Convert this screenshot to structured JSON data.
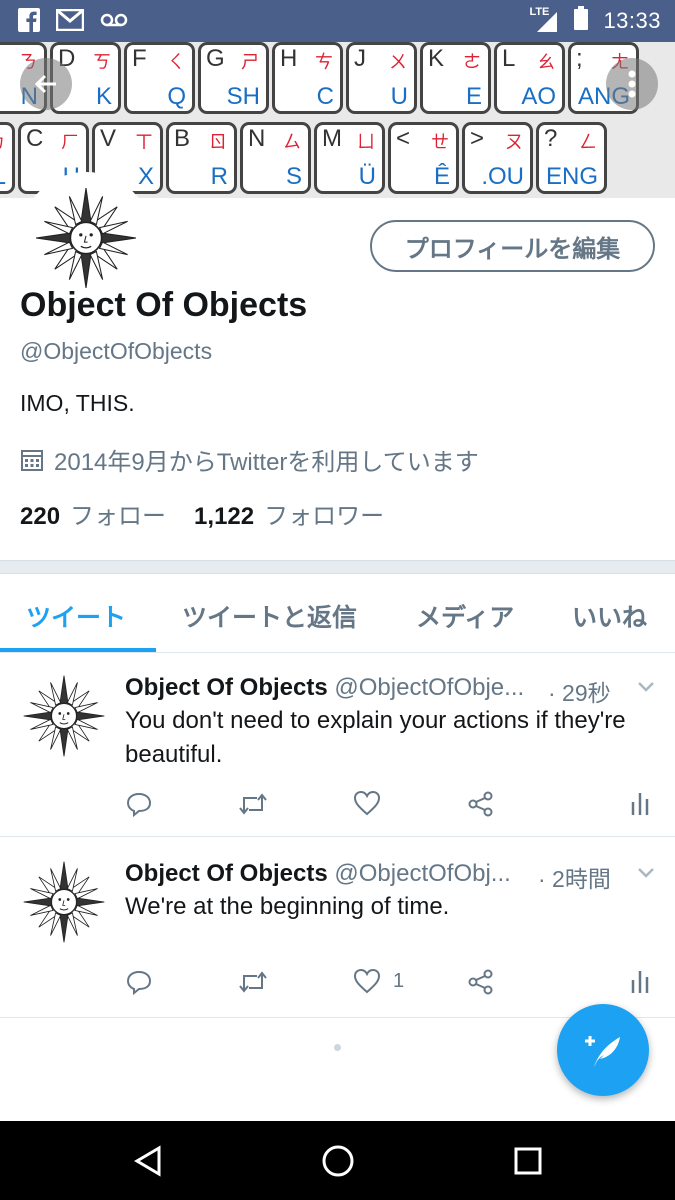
{
  "status_bar": {
    "time": "13:33",
    "network": "LTE",
    "notification_icons": [
      "facebook-icon",
      "gmail-icon",
      "voicemail-icon"
    ],
    "background": "#4a5f8a"
  },
  "banner": {
    "row1": [
      {
        "tl": "S",
        "tr": "ㄋ",
        "bt": "N"
      },
      {
        "tl": "D",
        "tr": "ㄎ",
        "bt": "K"
      },
      {
        "tl": "F",
        "tr": "ㄑ",
        "bt": "Q"
      },
      {
        "tl": "G",
        "tr": "ㄕ",
        "bt": "SH"
      },
      {
        "tl": "H",
        "tr": "ㄘ",
        "bt": "C"
      },
      {
        "tl": "J",
        "tr": "ㄨ",
        "bt": "U"
      },
      {
        "tl": "K",
        "tr": "ㄜ",
        "bt": "E"
      },
      {
        "tl": "L",
        "tr": "ㄠ",
        "bt": "AO"
      },
      {
        "tl": ";",
        "tr": "ㄤ",
        "bt": "ANG"
      }
    ],
    "row2": [
      {
        "tl": "X",
        "tr": "ㄌ",
        "bt": "L"
      },
      {
        "tl": "C",
        "tr": "ㄏ",
        "bt": "H"
      },
      {
        "tl": "V",
        "tr": "ㄒ",
        "bt": "X"
      },
      {
        "tl": "B",
        "tr": "ㄖ",
        "bt": "R"
      },
      {
        "tl": "N",
        "tr": "ㄙ",
        "bt": "S"
      },
      {
        "tl": "M",
        "tr": "ㄩ",
        "bt": "Ü"
      },
      {
        "tl": "<",
        "tr": "ㄝ",
        "bt": "Ê"
      },
      {
        "tl": ">",
        "tr": "ㄡ",
        "bt": ".OU"
      },
      {
        "tl": "?",
        "tr": "ㄥ",
        "bt": "ENG"
      }
    ]
  },
  "profile": {
    "edit_button": "プロフィールを編集",
    "name": "Object Of Objects",
    "handle": "@ObjectOfObjects",
    "bio": "IMO, THIS.",
    "joined": "2014年9月からTwitterを利用しています",
    "following_count": "220",
    "following_label": "フォロー",
    "followers_count": "1,122",
    "followers_label": "フォロワー"
  },
  "tabs": [
    {
      "label": "ツイート",
      "active": true
    },
    {
      "label": "ツイートと返信",
      "active": false
    },
    {
      "label": "メディア",
      "active": false
    },
    {
      "label": "いいね",
      "active": false
    }
  ],
  "tweets": [
    {
      "name": "Object Of Objects",
      "handle": "@ObjectOfObje...",
      "time": "· 29秒",
      "text": "You don't need to explain your actions if they're beautiful.",
      "like_count": ""
    },
    {
      "name": "Object Of Objects",
      "handle": "@ObjectOfObj...",
      "time": "· 2時間",
      "text": "We're at the beginning of time.",
      "like_count": "1"
    }
  ],
  "colors": {
    "accent": "#1da1f2",
    "secondary_text": "#657786",
    "primary_text": "#14171a"
  }
}
